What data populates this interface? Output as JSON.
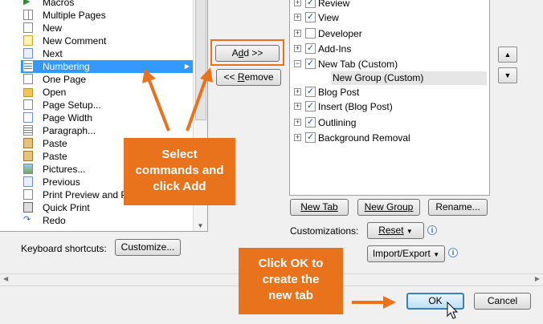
{
  "commands": {
    "items": [
      {
        "label": "Macros",
        "icon": "macros-icon"
      },
      {
        "label": "Multiple Pages",
        "icon": "multiple-pages-icon"
      },
      {
        "label": "New",
        "icon": "new-document-icon"
      },
      {
        "label": "New Comment",
        "icon": "new-comment-icon"
      },
      {
        "label": "Next",
        "icon": "next-icon"
      },
      {
        "label": "Numbering",
        "icon": "numbering-icon",
        "selected": true
      },
      {
        "label": "One Page",
        "icon": "one-page-icon"
      },
      {
        "label": "Open",
        "icon": "open-folder-icon"
      },
      {
        "label": "Page Setup...",
        "icon": "page-setup-icon"
      },
      {
        "label": "Page Width",
        "icon": "page-width-icon"
      },
      {
        "label": "Paragraph...",
        "icon": "paragraph-icon"
      },
      {
        "label": "Paste",
        "icon": "paste-icon"
      },
      {
        "label": "Paste",
        "icon": "paste-icon"
      },
      {
        "label": "Pictures...",
        "icon": "pictures-icon"
      },
      {
        "label": "Previous",
        "icon": "previous-icon"
      },
      {
        "label": "Print Preview and P",
        "icon": "print-preview-icon"
      },
      {
        "label": "Quick Print",
        "icon": "quick-print-icon"
      },
      {
        "label": "Redo",
        "icon": "redo-icon"
      }
    ]
  },
  "buttons": {
    "add_prefix": "A",
    "add_underline": "d",
    "add_suffix": "d >>",
    "remove_prefix": "<< ",
    "remove_underline": "R",
    "remove_suffix": "emove",
    "customize": "Customize...",
    "new_tab": "New Tab",
    "new_group": "New Group",
    "rename": "Rename...",
    "reset": "Reset",
    "import_export": "Import/Export",
    "ok": "OK",
    "cancel": "Cancel"
  },
  "labels": {
    "keyboard_shortcuts": "Keyboard shortcuts:",
    "customizations": "Customizations:"
  },
  "tabs": {
    "rows": [
      {
        "label": "Review",
        "checked": true,
        "expander": "+"
      },
      {
        "label": "View",
        "checked": true,
        "expander": "+"
      },
      {
        "label": "Developer",
        "checked": false,
        "expander": "+"
      },
      {
        "label": "Add-Ins",
        "checked": true,
        "expander": "+"
      },
      {
        "label": "New Tab (Custom)",
        "checked": true,
        "expander": "−"
      },
      {
        "label": "Blog Post",
        "checked": true,
        "expander": "+"
      },
      {
        "label": "Insert (Blog Post)",
        "checked": true,
        "expander": "+"
      },
      {
        "label": "Outlining",
        "checked": true,
        "expander": "+"
      },
      {
        "label": "Background Removal",
        "checked": true,
        "expander": "+"
      }
    ],
    "new_group_label": "New Group (Custom)"
  },
  "callouts": {
    "select": "Select commands and click Add",
    "click_ok": "Click OK to create the new tab"
  },
  "colors": {
    "accent_orange": "#e8731c",
    "selection_blue": "#3399ff"
  }
}
